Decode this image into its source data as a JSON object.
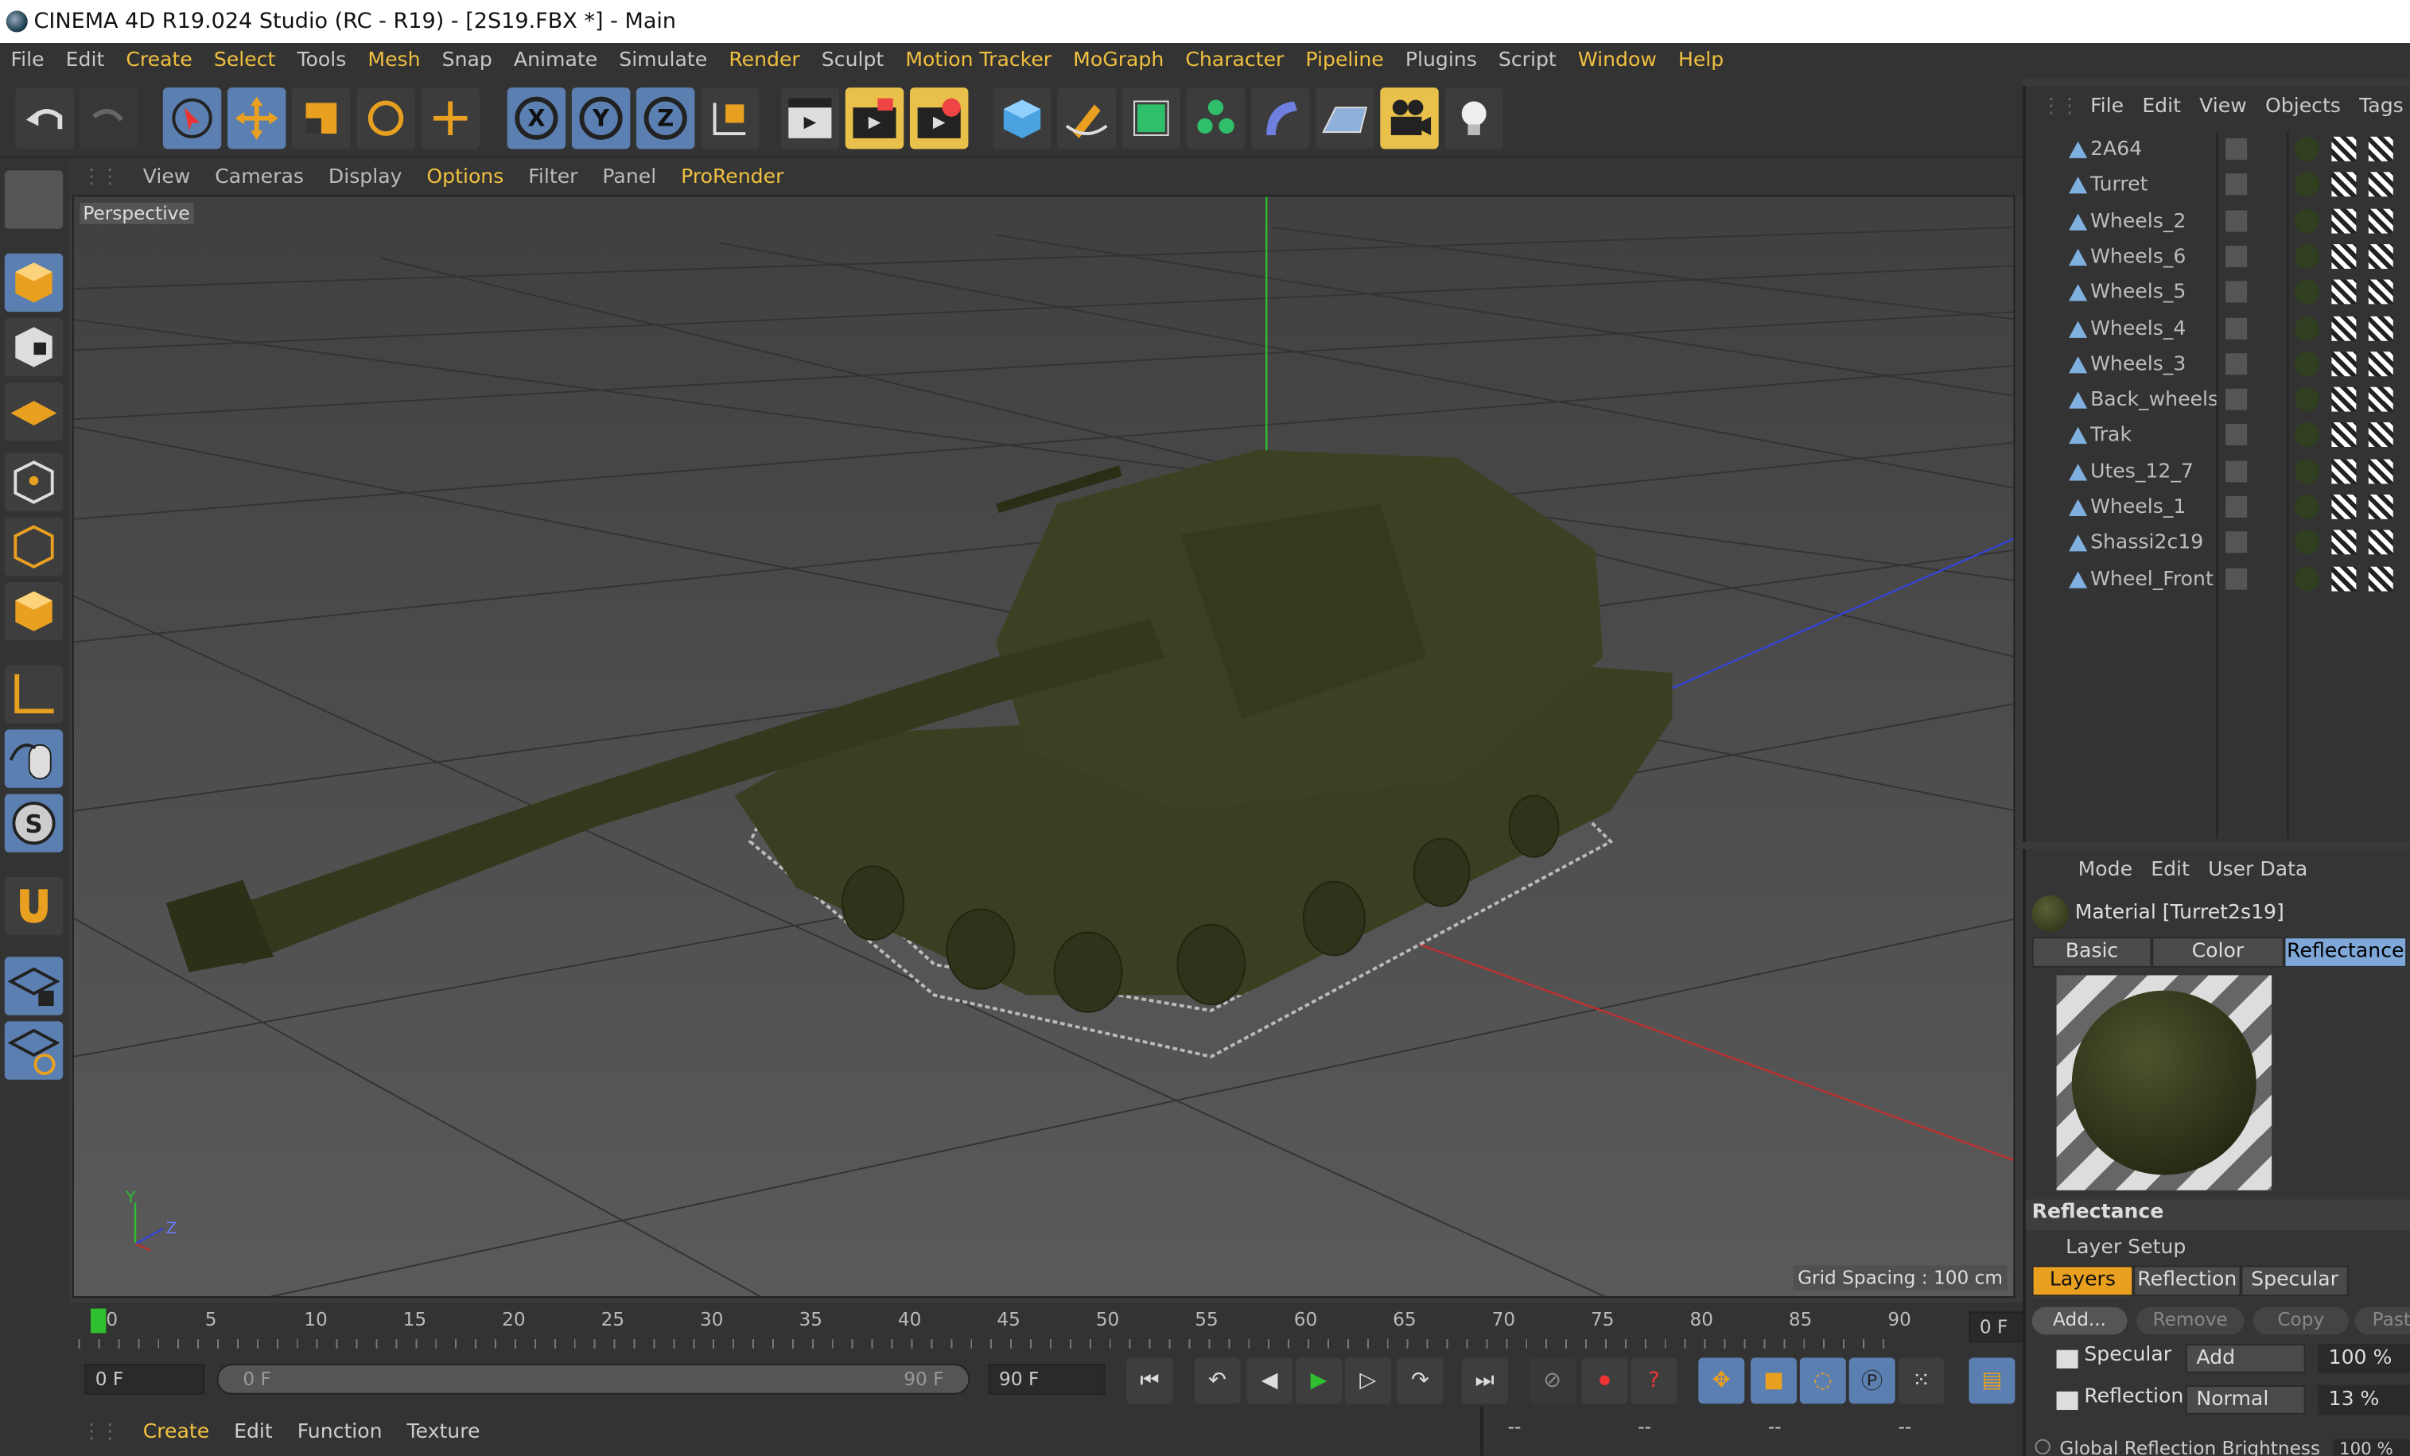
{
  "window": {
    "title": "CINEMA 4D R19.024 Studio (RC - R19) - [2S19.FBX *] - Main"
  },
  "menubar": [
    {
      "label": "File",
      "hl": false
    },
    {
      "label": "Edit",
      "hl": false
    },
    {
      "label": "Create",
      "hl": true
    },
    {
      "label": "Select",
      "hl": true
    },
    {
      "label": "Tools",
      "hl": false
    },
    {
      "label": "Mesh",
      "hl": true
    },
    {
      "label": "Snap",
      "hl": false
    },
    {
      "label": "Animate",
      "hl": false
    },
    {
      "label": "Simulate",
      "hl": false
    },
    {
      "label": "Render",
      "hl": true
    },
    {
      "label": "Sculpt",
      "hl": false
    },
    {
      "label": "Motion Tracker",
      "hl": true
    },
    {
      "label": "MoGraph",
      "hl": true
    },
    {
      "label": "Character",
      "hl": true
    },
    {
      "label": "Pipeline",
      "hl": true
    },
    {
      "label": "Plugins",
      "hl": false
    },
    {
      "label": "Script",
      "hl": false
    },
    {
      "label": "Window",
      "hl": true
    },
    {
      "label": "Help",
      "hl": true
    }
  ],
  "toolbar": {
    "axis_x": "X",
    "axis_y": "Y",
    "axis_z": "Z"
  },
  "viewport": {
    "menu": [
      {
        "label": "View",
        "hl": false
      },
      {
        "label": "Cameras",
        "hl": false
      },
      {
        "label": "Display",
        "hl": false
      },
      {
        "label": "Options",
        "hl": true
      },
      {
        "label": "Filter",
        "hl": false
      },
      {
        "label": "Panel",
        "hl": false
      },
      {
        "label": "ProRender",
        "hl": true
      }
    ],
    "camera_label": "Perspective",
    "grid_spacing": "Grid Spacing : 100 cm",
    "axis_y": "Y",
    "axis_z": "Z"
  },
  "timeline": {
    "ticks": [
      "0",
      "5",
      "10",
      "15",
      "20",
      "25",
      "30",
      "35",
      "40",
      "45",
      "50",
      "55",
      "60",
      "65",
      "70",
      "75",
      "80",
      "85",
      "90"
    ],
    "current_frame": "0 F"
  },
  "transport": {
    "start_field": "0 F",
    "range_start": "0 F",
    "range_end": "90 F",
    "end_field": "90 F"
  },
  "material_manager": {
    "menu": [
      "Create",
      "Edit",
      "Function",
      "Texture"
    ],
    "status": [
      "--",
      "--",
      "--",
      "--"
    ]
  },
  "object_manager": {
    "menu": [
      "File",
      "Edit",
      "View",
      "Objects",
      "Tags"
    ],
    "objects": [
      "2A64",
      "Turret",
      "Wheels_2",
      "Wheels_6",
      "Wheels_5",
      "Wheels_4",
      "Wheels_3",
      "Back_wheels",
      "Trak",
      "Utes_12_7",
      "Wheels_1",
      "Shassi2c19",
      "Wheel_Front"
    ]
  },
  "attributes": {
    "menu": [
      "Mode",
      "Edit",
      "User Data"
    ],
    "title": "Material [Turret2s19]",
    "tabs": [
      "Basic",
      "Color",
      "Reflectance"
    ],
    "active_tab": "Reflectance",
    "section": "Reflectance",
    "layer_setup": "Layer Setup",
    "sub_tabs": [
      "Layers",
      "Reflection",
      "Specular"
    ],
    "active_sub_tab": "Layers",
    "buttons": [
      "Add...",
      "Remove",
      "Copy",
      "Past"
    ],
    "layers": [
      {
        "name": "Specular",
        "mode": "Add",
        "value": "100 %"
      },
      {
        "name": "Reflection",
        "mode": "Normal",
        "value": "13 %"
      }
    ],
    "global_reflection_label": "Global Reflection Brightness",
    "global_reflection_value": "100 %"
  },
  "colors": {
    "accent_blue": "#7fa7d8",
    "accent_gold": "#e9c14a",
    "highlight_text": "#f0c040",
    "model_green": "#3b3f22"
  }
}
